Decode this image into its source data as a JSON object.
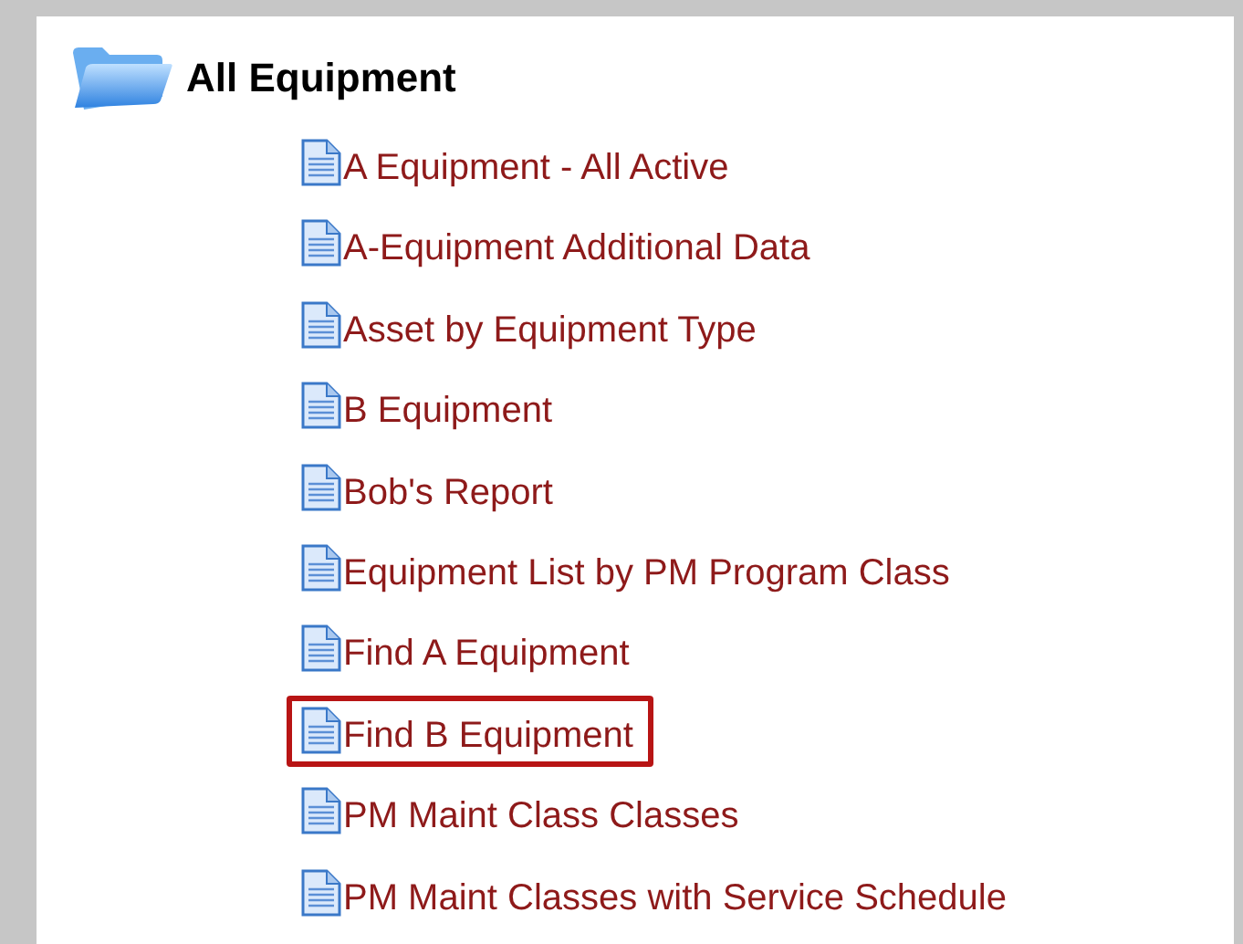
{
  "folder": {
    "label": "All Equipment",
    "children": [
      {
        "label": "A Equipment - All Active",
        "selected": false
      },
      {
        "label": "A-Equipment Additional Data",
        "selected": false
      },
      {
        "label": "Asset by Equipment Type",
        "selected": false
      },
      {
        "label": "B Equipment",
        "selected": false
      },
      {
        "label": "Bob's Report",
        "selected": false
      },
      {
        "label": "Equipment List by PM Program Class",
        "selected": false
      },
      {
        "label": "Find A Equipment",
        "selected": false
      },
      {
        "label": "Find B Equipment",
        "selected": true
      },
      {
        "label": "PM Maint Class Classes",
        "selected": false
      },
      {
        "label": "PM Maint Classes with Service Schedule",
        "selected": false
      }
    ]
  }
}
